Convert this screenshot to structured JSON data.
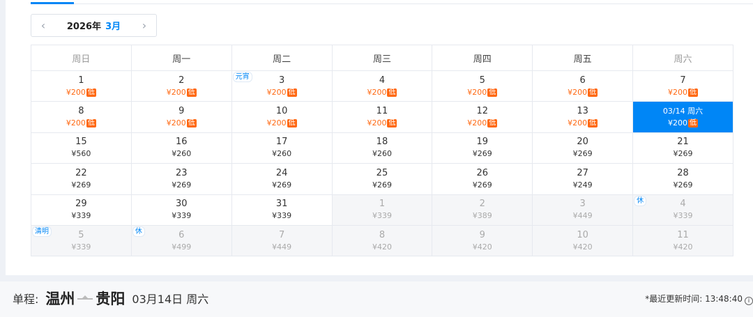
{
  "calendar": {
    "nav": {
      "year": "2026年",
      "month": "3月",
      "prev_icon": "chevron-left",
      "next_icon": "chevron-right"
    },
    "weekdays": [
      "周日",
      "周一",
      "周二",
      "周三",
      "周四",
      "周五",
      "周六"
    ],
    "weeks": [
      [
        {
          "day": "1",
          "price": "¥200",
          "low": true
        },
        {
          "day": "2",
          "price": "¥200",
          "low": true
        },
        {
          "day": "3",
          "price": "¥200",
          "low": true,
          "tag": "元宵"
        },
        {
          "day": "4",
          "price": "¥200",
          "low": true
        },
        {
          "day": "5",
          "price": "¥200",
          "low": true
        },
        {
          "day": "6",
          "price": "¥200",
          "low": true
        },
        {
          "day": "7",
          "price": "¥200",
          "low": true
        }
      ],
      [
        {
          "day": "8",
          "price": "¥200",
          "low": true
        },
        {
          "day": "9",
          "price": "¥200",
          "low": true
        },
        {
          "day": "10",
          "price": "¥200",
          "low": true
        },
        {
          "day": "11",
          "price": "¥200",
          "low": true
        },
        {
          "day": "12",
          "price": "¥200",
          "low": true
        },
        {
          "day": "13",
          "price": "¥200",
          "low": true
        },
        {
          "day": "03/14 周六",
          "price": "¥200",
          "low": true,
          "selected": true
        }
      ],
      [
        {
          "day": "15",
          "price": "¥560"
        },
        {
          "day": "16",
          "price": "¥260"
        },
        {
          "day": "17",
          "price": "¥260"
        },
        {
          "day": "18",
          "price": "¥260"
        },
        {
          "day": "19",
          "price": "¥269"
        },
        {
          "day": "20",
          "price": "¥269"
        },
        {
          "day": "21",
          "price": "¥269"
        }
      ],
      [
        {
          "day": "22",
          "price": "¥269"
        },
        {
          "day": "23",
          "price": "¥269"
        },
        {
          "day": "24",
          "price": "¥269"
        },
        {
          "day": "25",
          "price": "¥269"
        },
        {
          "day": "26",
          "price": "¥269"
        },
        {
          "day": "27",
          "price": "¥249"
        },
        {
          "day": "28",
          "price": "¥269"
        }
      ],
      [
        {
          "day": "29",
          "price": "¥339"
        },
        {
          "day": "30",
          "price": "¥339"
        },
        {
          "day": "31",
          "price": "¥339"
        },
        {
          "day": "1",
          "price": "¥339",
          "other": true
        },
        {
          "day": "2",
          "price": "¥389",
          "other": true
        },
        {
          "day": "3",
          "price": "¥449",
          "other": true
        },
        {
          "day": "4",
          "price": "¥339",
          "other": true,
          "tag": "休"
        }
      ],
      [
        {
          "day": "5",
          "price": "¥339",
          "other": true,
          "tag": "清明"
        },
        {
          "day": "6",
          "price": "¥499",
          "other": true,
          "tag": "休"
        },
        {
          "day": "7",
          "price": "¥449",
          "other": true
        },
        {
          "day": "8",
          "price": "¥420",
          "other": true
        },
        {
          "day": "9",
          "price": "¥420",
          "other": true
        },
        {
          "day": "10",
          "price": "¥420",
          "other": true
        },
        {
          "day": "11",
          "price": "¥420",
          "other": true
        }
      ]
    ],
    "low_label": "低"
  },
  "trip": {
    "type": "单程:",
    "from": "温州",
    "to": "贵阳",
    "date": "03月14日 周六",
    "plane_icon": "plane-icon"
  },
  "update": {
    "text": "*最近更新时间: 13:48:40",
    "icon": "info-icon"
  },
  "colors": {
    "accent": "#0086f6",
    "low_price": "#ff6913",
    "other_month_bg": "#f5f6f8"
  }
}
